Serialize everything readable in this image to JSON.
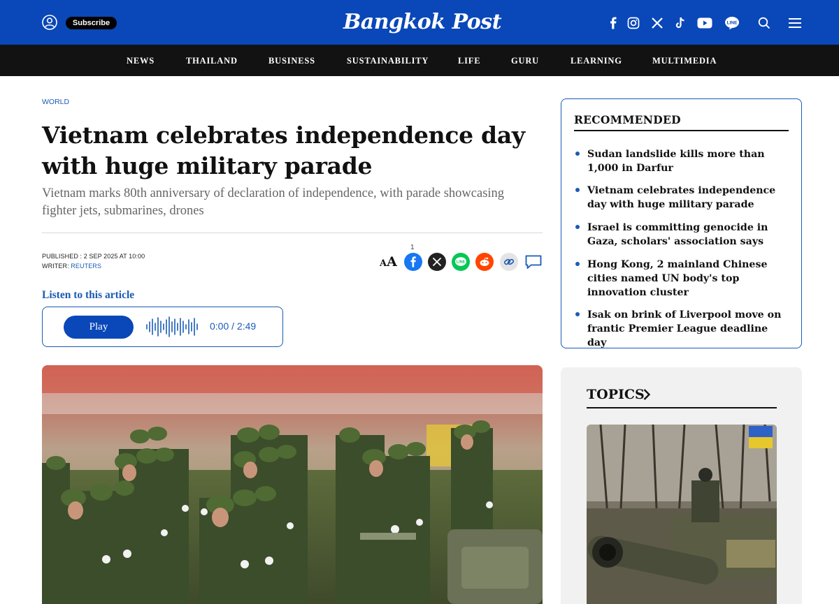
{
  "header": {
    "logo_text": "Bangkok Post",
    "subscribe_label": "Subscribe",
    "brand_color": "#0a47b8",
    "icons": [
      "user-icon",
      "facebook-icon",
      "instagram-icon",
      "x-icon",
      "tiktok-icon",
      "youtube-icon",
      "line-icon",
      "search-icon",
      "menu-icon"
    ]
  },
  "nav": {
    "items": [
      "NEWS",
      "THAILAND",
      "BUSINESS",
      "SUSTAINABILITY",
      "LIFE",
      "GURU",
      "LEARNING",
      "MULTIMEDIA"
    ]
  },
  "article": {
    "section": "WORLD",
    "headline": "Vietnam celebrates independence day with huge military parade",
    "subheadline": "Vietnam marks 80th anniversary of declaration of independence, with parade showcasing fighter jets, submarines, drones",
    "published_label": "PUBLISHED : 2 SEP 2025 AT 10:00",
    "writer_label": "WRITER: ",
    "writer": "REUTERS",
    "share_count": "1",
    "font_size_icon_text": "AA",
    "share_icons": [
      "font-size-icon",
      "facebook-share-icon",
      "x-share-icon",
      "line-share-icon",
      "reddit-share-icon",
      "copy-link-icon",
      "comment-icon"
    ]
  },
  "audio": {
    "listen_label": "Listen to this article",
    "play_label": "Play",
    "time": "0:00 / 2:49"
  },
  "sidebar": {
    "recommended_title": "RECOMMENDED",
    "recommended": [
      "Sudan landslide kills more than 1,000 in Darfur",
      "Vietnam celebrates independence day with huge military parade",
      "Israel is committing genocide in Gaza, scholars' association says",
      "Hong Kong, 2 mainland Chinese cities named UN body's top innovation cluster",
      "Isak on brink of Liverpool move on frantic Premier League deadline day"
    ],
    "topics_title": "TOPICS"
  }
}
